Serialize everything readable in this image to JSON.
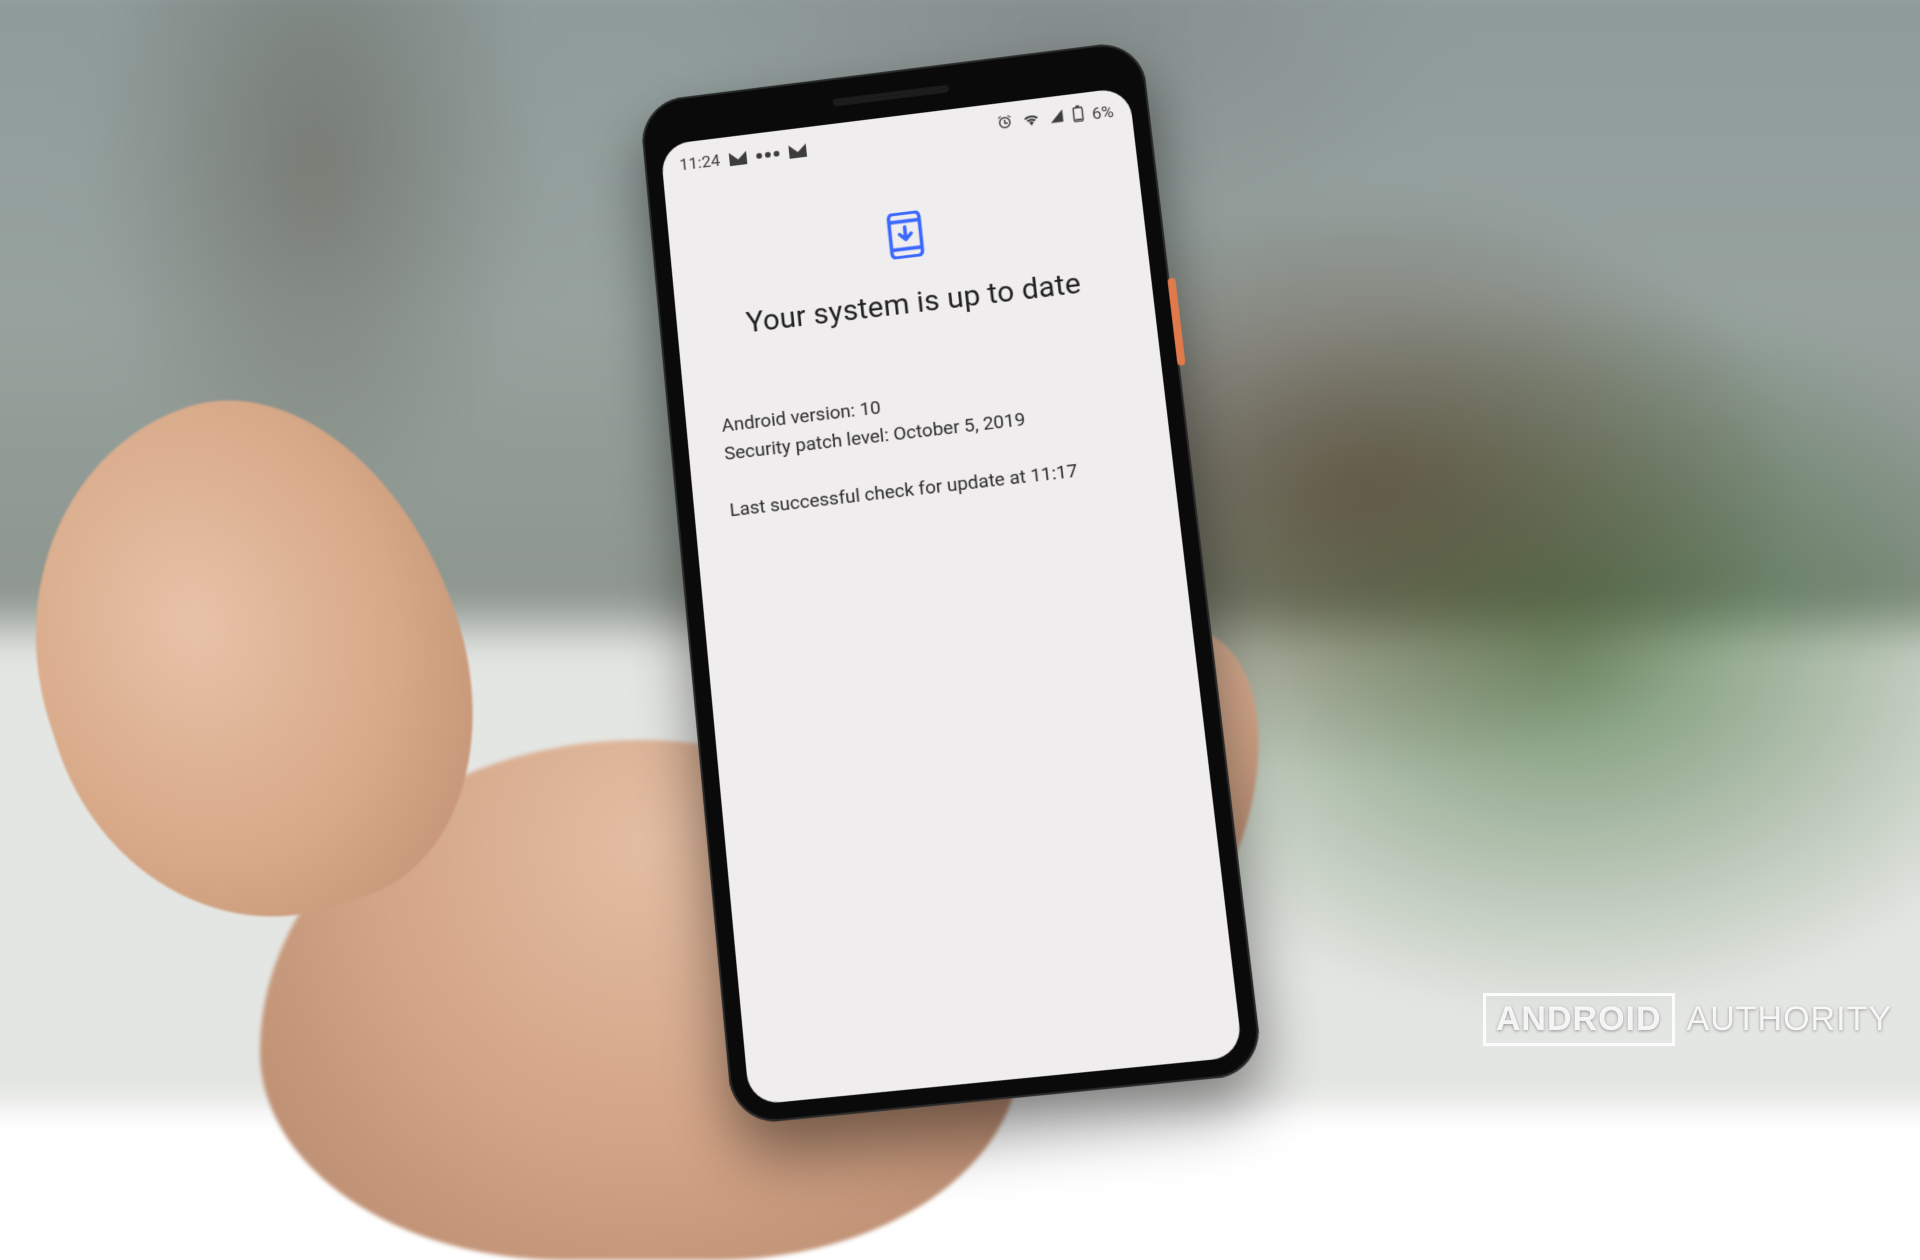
{
  "statusbar": {
    "time": "11:24",
    "battery_text": "6%",
    "icons_left": [
      "mail-icon",
      "dots-icon",
      "mail-icon"
    ],
    "icons_right": [
      "alarm-icon",
      "wifi-icon",
      "cell-signal-icon",
      "battery-icon"
    ]
  },
  "update_screen": {
    "title": "Your system is up to date",
    "android_version_line": "Android version: 10",
    "security_patch_line": "Security patch level: October 5, 2019",
    "last_check_line": "Last successful check for update at 11:17",
    "icon_color": "#3b68ff"
  },
  "watermark": {
    "brand_boxed": "ANDROID",
    "brand_rest": "AUTHORITY"
  }
}
